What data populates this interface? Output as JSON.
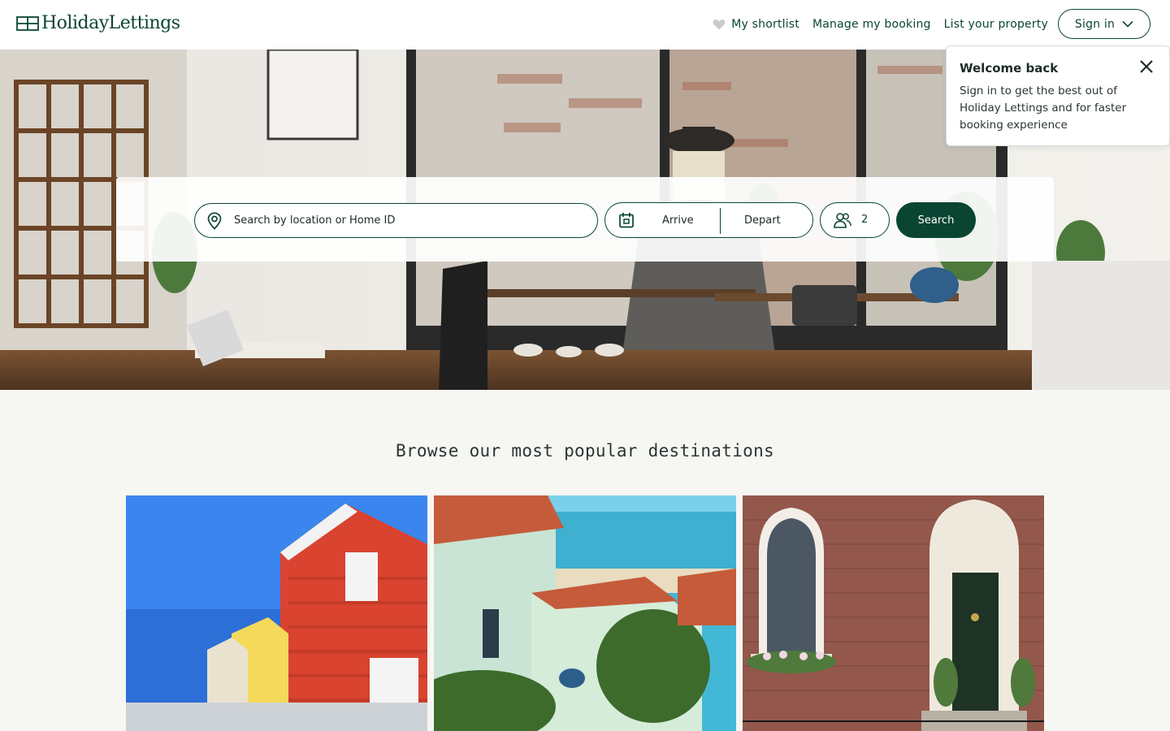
{
  "brand": {
    "name": "HolidayLettings",
    "accent": "#0a4533"
  },
  "nav": {
    "shortlist": "My shortlist",
    "manage": "Manage my booking",
    "list": "List your property",
    "signin": "Sign in"
  },
  "popover": {
    "title": "Welcome back",
    "body": "Sign in to get the best out of Holiday Lettings and for faster booking experience"
  },
  "search": {
    "placeholder": "Search by location or Home ID",
    "arrive": "Arrive",
    "depart": "Depart",
    "guests": "2",
    "button": "Search"
  },
  "destinations": {
    "title": "Browse our most popular destinations"
  },
  "icons": [
    "logo-icon",
    "heart-icon",
    "chevron-down-icon",
    "close-icon",
    "location-pin-icon",
    "calendar-icon",
    "guests-icon"
  ]
}
